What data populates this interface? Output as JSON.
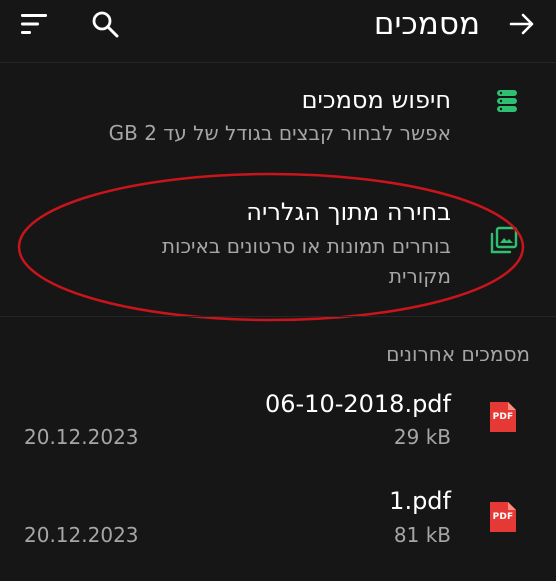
{
  "appbar": {
    "title": "מסמכים",
    "back_icon": "arrow-right-icon",
    "sort_icon": "sort-icon",
    "search_icon": "search-icon"
  },
  "options": [
    {
      "icon": "storage-icon",
      "title": "חיפוש מסמכים",
      "description": "אפשר לבחור קבצים בגודל של עד 2 GB"
    },
    {
      "icon": "gallery-icon",
      "title": "בחירה מתוך הגלריה",
      "description": "בוחרים תמונות או סרטונים באיכות מקורית"
    }
  ],
  "recent": {
    "header": "מסמכים אחרונים",
    "files": [
      {
        "icon_label": "PDF",
        "name": "06-10-2018.pdf",
        "size": "29 kB",
        "date": "20.12.2023"
      },
      {
        "icon_label": "PDF",
        "name": "1.pdf",
        "size": "81 kB",
        "date": "20.12.2023"
      }
    ]
  },
  "colors": {
    "background": "#161616",
    "accent_green": "#2fbf71",
    "pdf_red": "#e53935",
    "highlight_red": "#c8151c"
  }
}
